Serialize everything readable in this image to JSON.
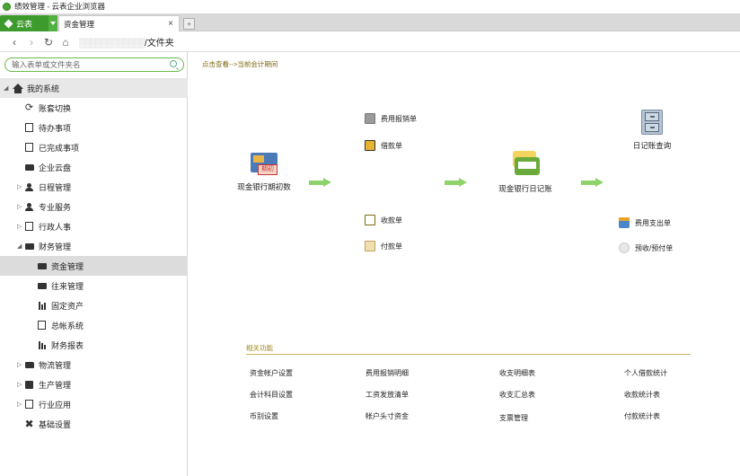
{
  "window": {
    "title": "绩效管理 - 云表企业浏览器"
  },
  "tabbar": {
    "brand": "云表",
    "tab_label": "资金管理",
    "close_label": "×",
    "new_tab_label": "+"
  },
  "navbar": {
    "address_tail": "/文件夹"
  },
  "sidebar": {
    "search_placeholder": "输入表单或文件夹名",
    "root_label": "我的系统",
    "items": [
      {
        "label": "账套切换",
        "icon": "sync-icon"
      },
      {
        "label": "待办事项",
        "icon": "todo-icon"
      },
      {
        "label": "已完成事项",
        "icon": "done-icon"
      },
      {
        "label": "企业云盘",
        "icon": "folder-icon"
      },
      {
        "label": "日程管理",
        "icon": "schedule-icon"
      },
      {
        "label": "专业服务",
        "icon": "person-icon"
      },
      {
        "label": "行政人事",
        "icon": "admin-icon"
      },
      {
        "label": "财务管理",
        "icon": "finance-icon"
      },
      {
        "label": "资金管理",
        "icon": "fund-icon"
      },
      {
        "label": "往来管理",
        "icon": "card-icon"
      },
      {
        "label": "固定资产",
        "icon": "asset-icon"
      },
      {
        "label": "总帐系统",
        "icon": "ledger-icon"
      },
      {
        "label": "财务报表",
        "icon": "report-icon"
      },
      {
        "label": "物流管理",
        "icon": "logistics-icon"
      },
      {
        "label": "生产管理",
        "icon": "production-icon"
      },
      {
        "label": "行业应用",
        "icon": "industry-icon"
      },
      {
        "label": "基础设置",
        "icon": "settings-icon"
      }
    ]
  },
  "main": {
    "breadcrumb": "点击查看-->当前会计期间",
    "flow": {
      "cash_bank_init": "现金银行期初数",
      "expense_claim": "费用报销单",
      "loan_form": "借款单",
      "receipt_form": "收款单",
      "payment_form": "付款单",
      "cash_bank_journal": "现金银行日记账",
      "journal_query": "日记账查询",
      "expense_payment": "费用支出单",
      "advance_form": "预收/预付单",
      "period_badge": "期初"
    },
    "related_title": "相关功能",
    "related": [
      [
        "资金帐户设置",
        "费用报销明细",
        "收支明细表",
        "个人借款统计"
      ],
      [
        "会计科目设置",
        "工资发放清单",
        "收支汇总表",
        "收款统计表"
      ],
      [
        "币别设置",
        "帐户头寸资金",
        "支票管理",
        "付款统计表"
      ]
    ]
  }
}
